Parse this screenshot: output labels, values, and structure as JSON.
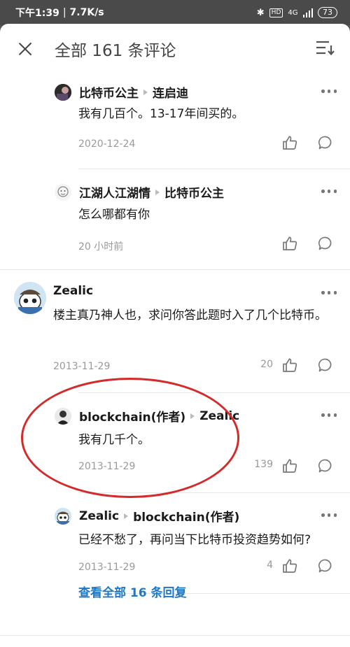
{
  "status_bar": {
    "time": "下午1:39",
    "speed": "7.7K/s",
    "hd": "HD",
    "network": "4G",
    "battery": "73"
  },
  "header": {
    "title": "全部 161 条评论"
  },
  "comments": [
    {
      "author": "比特币公主",
      "reply_to": "连启迪",
      "text": "我有几百个。13-17年间买的。",
      "date": "2020-12-24",
      "likes": ""
    },
    {
      "author": "江湖人江湖情",
      "reply_to": "比特币公主",
      "text": "怎么哪都有你",
      "date": "20 小时前",
      "likes": ""
    },
    {
      "author": "Zealic",
      "reply_to": "",
      "text": "楼主真乃神人也，求问你答此题时入了几个比特币。",
      "date": "2013-11-29",
      "likes": "20"
    },
    {
      "author": "blockchain(作者)",
      "reply_to": "Zealic",
      "text": "我有几千个。",
      "date": "2013-11-29",
      "likes": "139"
    },
    {
      "author": "Zealic",
      "reply_to": "blockchain(作者)",
      "text": "已经不愁了，再问当下比特币投资趋势如何?",
      "date": "2013-11-29",
      "likes": "4"
    }
  ],
  "view_all": "查看全部 16 条回复",
  "colors": {
    "link": "#1e78c8",
    "annotation": "#d42a2a"
  }
}
